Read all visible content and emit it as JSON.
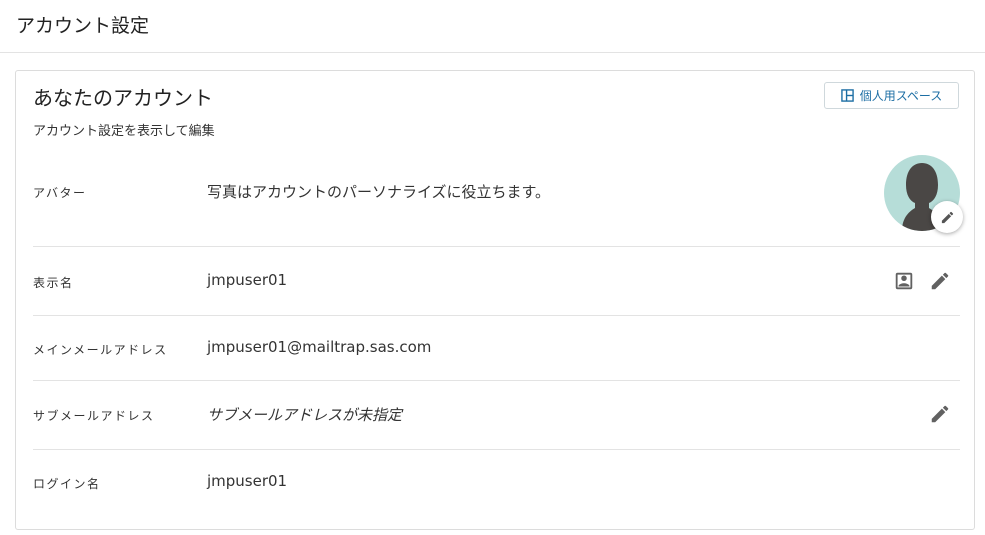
{
  "header": {
    "title": "アカウント設定"
  },
  "card": {
    "title": "あなたのアカウント",
    "subtitle": "アカウント設定を表示して編集",
    "space_button_label": "個人用スペース"
  },
  "rows": {
    "avatar": {
      "label": "アバター",
      "value": "写真はアカウントのパーソナライズに役立ちます。"
    },
    "display_name": {
      "label": "表示名",
      "value": "jmpuser01"
    },
    "primary_email": {
      "label": "メインメールアドレス",
      "value": "jmpuser01@mailtrap.sas.com"
    },
    "secondary_email": {
      "label": "サブメールアドレス",
      "value": "サブメールアドレスが未指定"
    },
    "login_name": {
      "label": "ログイン名",
      "value": "jmpuser01"
    }
  },
  "colors": {
    "accent": "#1c6ea4",
    "avatar_bg": "#b6ddd8",
    "avatar_silhouette": "#4a4745",
    "divider": "#e3e3e3"
  },
  "icons": {
    "space_button": "layout-icon",
    "avatar_edit": "pencil-icon",
    "display_name_contact": "contact-card-icon",
    "display_name_edit": "pencil-icon",
    "secondary_email_edit": "pencil-icon"
  }
}
